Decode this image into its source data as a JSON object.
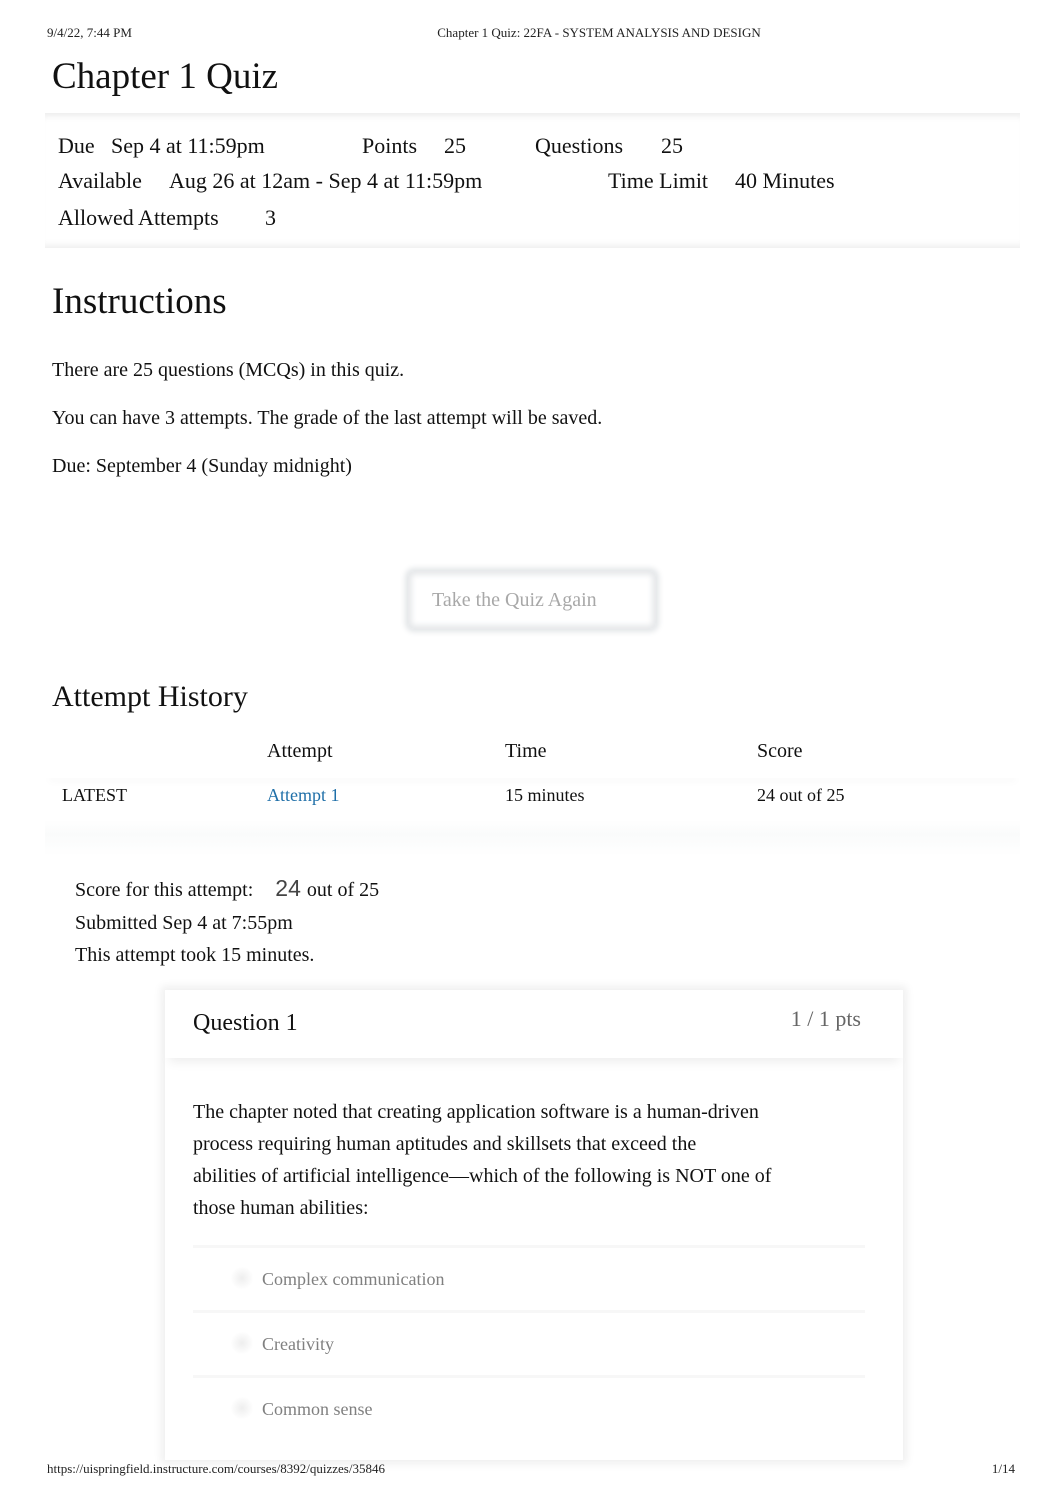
{
  "print_header": {
    "datetime": "9/4/22, 7:44 PM",
    "page_title": "Chapter 1 Quiz: 22FA - SYSTEM ANALYSIS AND DESIGN"
  },
  "quiz": {
    "title": "Chapter 1 Quiz",
    "details": {
      "due_label": "Due",
      "due_value": "Sep 4 at 11:59pm",
      "points_label": "Points",
      "points_value": "25",
      "questions_label": "Questions",
      "questions_value": "25",
      "available_label": "Available",
      "available_value": "Aug 26 at 12am - Sep 4 at 11:59pm",
      "time_limit_label": "Time Limit",
      "time_limit_value": "40 Minutes",
      "allowed_attempts_label": "Allowed Attempts",
      "allowed_attempts_value": "3"
    }
  },
  "instructions": {
    "heading": "Instructions",
    "paragraphs": [
      "There are 25 questions (MCQs) in this quiz.",
      "You can have 3 attempts. The grade of the last attempt will be saved.",
      "Due: September 4 (Sunday midnight)"
    ]
  },
  "take_quiz_button": "Take the Quiz Again",
  "attempt_history": {
    "heading": "Attempt History",
    "columns": [
      "",
      "Attempt",
      "Time",
      "Score"
    ],
    "rows": [
      {
        "tag": "LATEST",
        "attempt": "Attempt 1",
        "time": "15 minutes",
        "score": "24 out of 25"
      }
    ]
  },
  "attempt_summary": {
    "score_label": "Score for this attempt:",
    "score_value": "24",
    "score_total": "out of 25",
    "submitted": "Submitted Sep 4 at 7:55pm",
    "duration": "This attempt took 15 minutes."
  },
  "question": {
    "name": "Question 1",
    "points": "1 / 1 pts",
    "text_lines": [
      "The chapter noted that creating application software is a human-driven",
      "process requiring human aptitudes and skillsets that exceed the",
      "abilities of artificial intelligence—which of the following is NOT one of",
      "those human abilities:"
    ],
    "answers": [
      "Complex communication",
      "Creativity",
      "Common sense"
    ]
  },
  "print_footer": {
    "url": "https://uispringfield.instructure.com/courses/8392/quizzes/35846",
    "page": "1/14"
  }
}
